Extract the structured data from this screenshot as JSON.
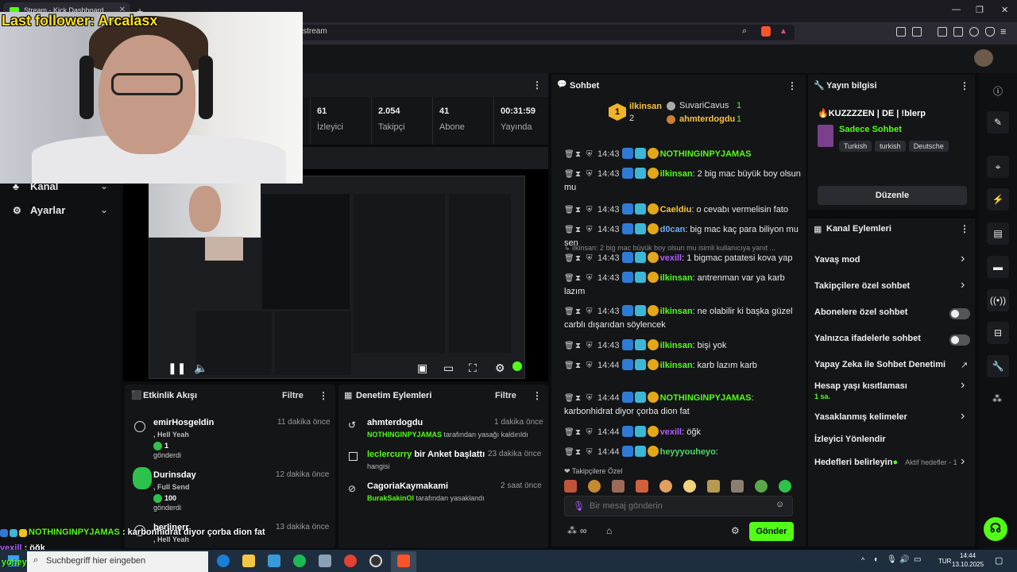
{
  "browser": {
    "tab_title": "Stream - Kick Dashboard",
    "url_tail": "m/stream",
    "new_tab": "+",
    "window_controls": [
      "—",
      "❐",
      "✕"
    ]
  },
  "overlay": {
    "last_follower": "Last follower: Arcalasx"
  },
  "nav": {
    "channel_label": "Kanal",
    "settings_label": "Ayarlar"
  },
  "stats": [
    {
      "value": "61",
      "label": "İzleyici"
    },
    {
      "value": "2.054",
      "label": "Takipçi"
    },
    {
      "value": "41",
      "label": "Abone"
    },
    {
      "value": "00:31:59",
      "label": "Yayında"
    }
  ],
  "activity": {
    "title": "Etkinlik Akışı",
    "filter": "Filtre",
    "items": [
      {
        "name": "emirHosgeldin",
        "time": "11 dakika önce",
        "line1": ", Hell Yeah",
        "line2": "1",
        "line3": "gönderdi"
      },
      {
        "name": "Durinsday",
        "time": "12 dakika önce",
        "line1": ", Full Send",
        "line2": "100",
        "line3": "gönderdi"
      },
      {
        "name": "berlinerr",
        "time": "13 dakika önce",
        "line1": ", Hell Yeah",
        "line2": "",
        "line3": ""
      }
    ]
  },
  "moderation": {
    "title": "Denetim Eylemleri",
    "filter": "Filtre",
    "items": [
      {
        "name": "ahmterdogdu",
        "time": "1 dakika önce",
        "actor": "NOTHINGINPYJAMAS",
        "text": " tarafından yasağı kaldırıldı"
      },
      {
        "name": "leclercurry",
        "name_suffix": " bir Anket başlattı",
        "time": "23 dakika önce",
        "actor": "",
        "text": "hangisi"
      },
      {
        "name": "CagoriaKaymakami",
        "time": "2 saat önce",
        "actor": "BurakSakinOl",
        "text": " tarafından yasaklandı"
      }
    ]
  },
  "chat": {
    "title": "Sohbet",
    "leaders": [
      {
        "name": "ilkinsan",
        "count": "2"
      },
      {
        "name": "SuvariCavus",
        "count": "1"
      },
      {
        "name": "ahmterdogdu",
        "count": "1"
      }
    ],
    "messages": [
      {
        "time": "14:43",
        "user": "NOTHINGINPYJAMAS",
        "color": "#53fc18",
        "text": ""
      },
      {
        "time": "14:43",
        "user": "ilkinsan",
        "color": "#53fc18",
        "text": ": 2 big mac büyük boy olsun mu"
      },
      {
        "time": "14:43",
        "user": "Caeldiu",
        "color": "#f6c343",
        "text": ": o cevabı vermelisin fato"
      },
      {
        "time": "14:43",
        "user": "d0can",
        "color": "#6ab0ff",
        "text": ": big mac kaç para biliyon mu sen"
      },
      {
        "reply": "↳ ilkinsan: 2 big mac büyük boy olsun mu isimli kullanıcıya yanıt ..."
      },
      {
        "time": "14:43",
        "user": "vexill",
        "color": "#b05cff",
        "text": ": 1 bigmac patatesi kova yap"
      },
      {
        "time": "14:43",
        "user": "ilkinsan",
        "color": "#53fc18",
        "text": ": antrenman var ya karb lazım"
      },
      {
        "time": "14:43",
        "user": "ilkinsan",
        "color": "#53fc18",
        "text": ": ne olabilir ki başka güzel carblı dışarıdan söylencek"
      },
      {
        "time": "14:43",
        "user": "ilkinsan",
        "color": "#53fc18",
        "text": ": bişi yok"
      },
      {
        "time": "14:44",
        "user": "ilkinsan",
        "color": "#53fc18",
        "text": ": karb lazım karb"
      },
      {
        "time": "14:44",
        "user": "NOTHINGINPYJAMAS",
        "color": "#53fc18",
        "text": ": karbonhidrat diyor çorba dion fat"
      },
      {
        "time": "14:44",
        "user": "vexill",
        "color": "#b05cff",
        "text": ": öğk"
      },
      {
        "time": "14:44",
        "user": "heyyyouheyo",
        "color": "#4cd964",
        "text": ":"
      }
    ],
    "follower_emotes_label": "Takipçilere Özel",
    "placeholder": "Bir mesaj gönderin",
    "send": "Gönder"
  },
  "stream_info": {
    "title": "Yayın bilgisi",
    "stream_title": "KUZZZZEN",
    "stream_title_suffix": " | DE | !blerp",
    "category": "Sadece Sohbet",
    "tags": [
      "Turkish",
      "turkish",
      "Deutsche"
    ],
    "edit": "Düzenle"
  },
  "channel_actions": {
    "title": "Kanal Eylemleri",
    "items": [
      {
        "label": "Yavaş mod",
        "control": "chevron"
      },
      {
        "label": "Takipçilere özel sohbet",
        "control": "chevron"
      },
      {
        "label": "Abonelere özel sohbet",
        "control": "toggle"
      },
      {
        "label": "Yalnızca ifadelerle sohbet",
        "control": "toggle"
      },
      {
        "label": "Yapay Zeka ile Sohbet Denetimi",
        "control": "external"
      },
      {
        "label": "Hesap yaşı kısıtlaması",
        "sub": "1 sa.",
        "control": "chevron"
      },
      {
        "label": "Yasaklanmış kelimeler",
        "control": "chevron"
      },
      {
        "label": "İzleyici Yönlendir",
        "control": "none"
      },
      {
        "label": "Hedefleri belirleyin",
        "sub": "Aktif hedefler - 1",
        "control": "chevron"
      }
    ]
  },
  "bottom_overlay": {
    "line1_user": "NOTHINGINPYJAMAS",
    "line1_text": " : karbonhidrat diyor çorba dion fat",
    "line2_user": "vexill",
    "line2_text": " : öğk",
    "line3_user": "yoheyo"
  },
  "taskbar": {
    "search_placeholder": "Suchbegriff hier eingeben",
    "lang": "TUR",
    "time": "14:44",
    "date": "13.10.2025"
  },
  "colors": {
    "accent": "#53fc18",
    "panel": "#141517",
    "bg": "#0b0c0e"
  }
}
